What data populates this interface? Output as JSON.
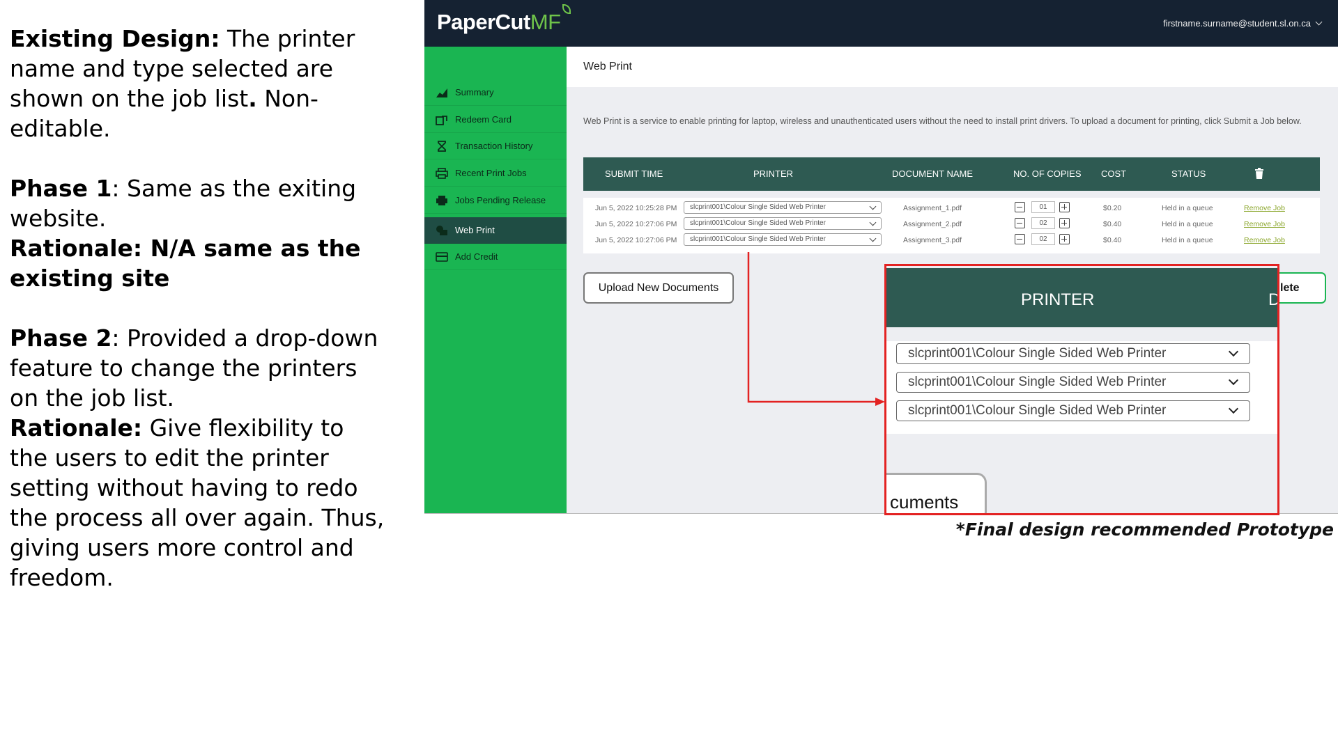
{
  "notes": {
    "existing_label": "Existing Design:",
    "existing_text": " The printer name and type selected are shown on the job list",
    "existing_dot": ".",
    "existing_tail": " Non-editable.",
    "phase1_label": "Phase 1",
    "phase1_text": ": Same as the exiting website.",
    "phase1_rationale": "Rationale: N/A same as the existing site",
    "phase2_label": "Phase 2",
    "phase2_text": ": Provided a drop-down feature to change the printers on the job list.",
    "phase2_rationale_label": "Rationale:",
    "phase2_rationale_text": " Give flexibility to the users to edit the printer setting without having to redo the process all over again. Thus, giving users more control and freedom."
  },
  "app": {
    "logo_main": "PaperCut",
    "logo_mf": "MF",
    "user_email": "firstname.surname@student.sl.on.ca"
  },
  "sidebar": {
    "items": [
      {
        "label": "Summary",
        "icon": "chart-icon"
      },
      {
        "label": "Redeem Card",
        "icon": "redeem-card-icon"
      },
      {
        "label": "Transaction History",
        "icon": "hourglass-icon"
      },
      {
        "label": "Recent Print Jobs",
        "icon": "printer-icon"
      },
      {
        "label": "Jobs Pending Release",
        "icon": "printer-pending-icon"
      },
      {
        "label": "Web Print",
        "icon": "web-print-icon"
      },
      {
        "label": "Add Credit",
        "icon": "credit-card-icon"
      }
    ],
    "active": "Web Print"
  },
  "page": {
    "title": "Web Print",
    "description": "Web Print is a service to enable printing for laptop, wireless and unauthenticated users without the need to install print drivers. To upload a document for printing, click Submit a Job below."
  },
  "table": {
    "headers": {
      "submit_time": "SUBMIT TIME",
      "printer": "PRINTER",
      "document": "DOCUMENT NAME",
      "copies": "NO. OF COPIES",
      "cost": "COST",
      "status": "STATUS",
      "delete_icon": "trash-icon"
    },
    "rows": [
      {
        "time": "Jun 5, 2022 10:25:28 PM",
        "printer": "slcprint001\\Colour Single Sided Web Printer",
        "document": "Assignment_1.pdf",
        "copies": "01",
        "cost": "$0.20",
        "status": "Held in a queue",
        "action": "Remove Job"
      },
      {
        "time": "Jun 5, 2022 10:27:06 PM",
        "printer": "slcprint001\\Colour Single Sided Web Printer",
        "document": "Assignment_2.pdf",
        "copies": "02",
        "cost": "$0.40",
        "status": "Held in a queue",
        "action": "Remove Job"
      },
      {
        "time": "Jun 5, 2022 10:27:06 PM",
        "printer": "slcprint001\\Colour Single Sided Web Printer",
        "document": "Assignment_3.pdf",
        "copies": "02",
        "cost": "$0.40",
        "status": "Held in a queue",
        "action": "Remove Job"
      }
    ]
  },
  "buttons": {
    "upload": "Upload New Documents",
    "delete_partial": "lete"
  },
  "zoom": {
    "header": "PRINTER",
    "header_partial": "D",
    "selects": [
      "slcprint001\\Colour Single Sided Web Printer",
      "slcprint001\\Colour Single Sided Web Printer",
      "slcprint001\\Colour Single Sided Web Printer"
    ],
    "button_partial": "cuments"
  },
  "caption": "*Final design recommended Prototype",
  "colors": {
    "topbar": "#152232",
    "sidebar": "#1ab552",
    "active_nav": "#1f4d44",
    "table_header": "#2e5a52",
    "callout": "#e32222",
    "link": "#8aa62a"
  }
}
